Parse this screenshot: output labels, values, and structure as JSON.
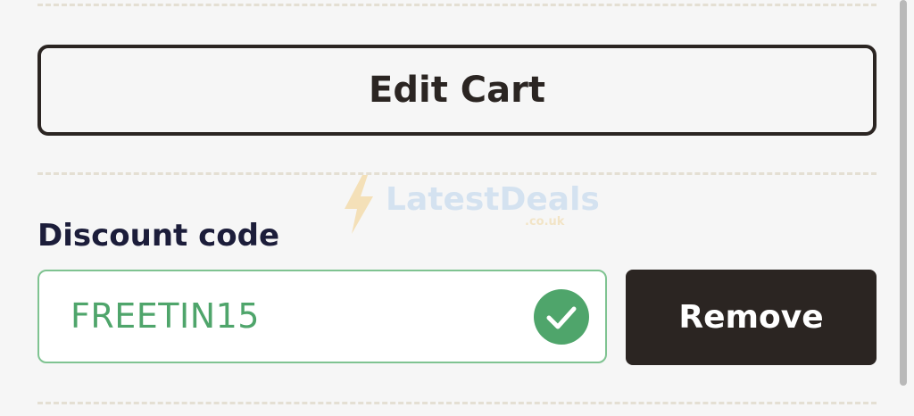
{
  "cart": {
    "edit_cart_label": "Edit Cart"
  },
  "discount": {
    "label": "Discount code",
    "code_value": "FREETIN15",
    "status": "applied",
    "status_icon": "check-circle-icon",
    "remove_label": "Remove"
  },
  "watermark": {
    "brand": "LatestDeals",
    "domain": ".co.uk",
    "icon": "lightning-bolt-icon"
  },
  "colors": {
    "background": "#f6f6f6",
    "button_dark": "#2b2522",
    "success_green": "#4fa56b",
    "success_border": "#7fc391",
    "label_navy": "#1c1d3a"
  }
}
